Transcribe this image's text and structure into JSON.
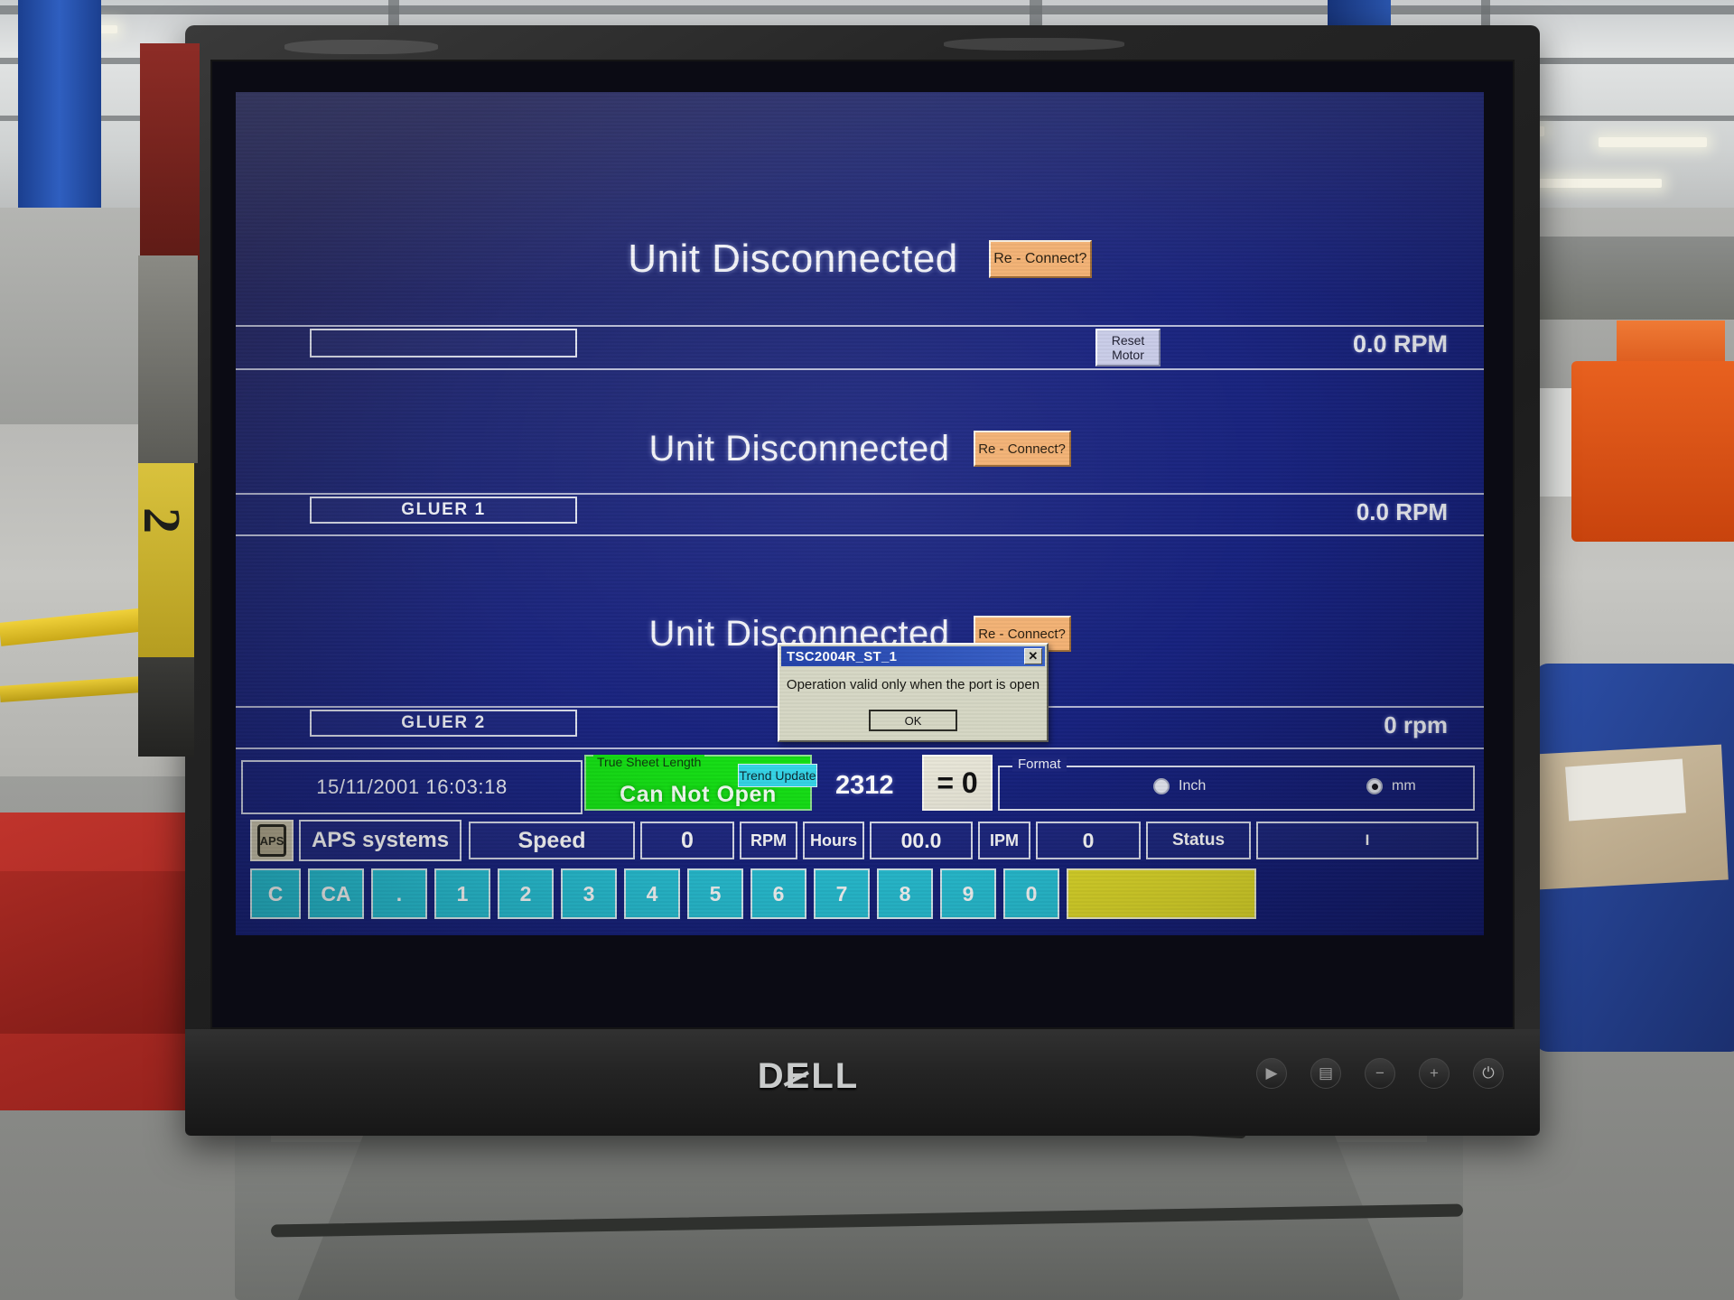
{
  "environment": {
    "scene": "factory-floor-warehouse",
    "monitor_brand": "DELL"
  },
  "screen": {
    "sections": [
      {
        "id": "unit-1",
        "status_text": "Unit Disconnected",
        "reconnect_label": "Re - Connect?",
        "field_value": "",
        "rpm_value": "0.0 RPM",
        "reset_motor_line1": "Reset",
        "reset_motor_line2": "Motor"
      },
      {
        "id": "unit-2",
        "status_text": "Unit Disconnected",
        "reconnect_label": "Re - Connect?",
        "field_value": "GLUER 1",
        "rpm_value": "0.0 RPM"
      },
      {
        "id": "unit-3",
        "status_text": "Unit Disconnected",
        "reconnect_label": "Re - Connect?",
        "field_value": "GLUER 2",
        "rpm_value": "0 rpm"
      }
    ],
    "status_strip": {
      "datetime": "15/11/2001 16:03:18",
      "true_sheet_length": {
        "legend": "True Sheet Length",
        "value": "Can Not Open",
        "trend_update_label": "Trend Update"
      },
      "counter_value": "2312",
      "equals_display": "= 0",
      "format": {
        "legend": "Format",
        "options": [
          {
            "label": "Inch",
            "selected": false
          },
          {
            "label": "mm",
            "selected": true
          }
        ]
      }
    },
    "toolbar": {
      "logo_text": "APS",
      "brand_label": "APS systems",
      "cells": [
        {
          "name": "speed-label",
          "text": "Speed"
        },
        {
          "name": "speed-value",
          "text": "0"
        },
        {
          "name": "rpm-unit",
          "text": "RPM"
        },
        {
          "name": "hours-label",
          "text": "Hours"
        },
        {
          "name": "hours-value",
          "text": "00.0"
        },
        {
          "name": "ipm-label",
          "text": "IPM"
        },
        {
          "name": "ipm-value",
          "text": "0"
        },
        {
          "name": "status-label",
          "text": "Status"
        },
        {
          "name": "status-value",
          "text": "I"
        }
      ]
    },
    "keypad": {
      "keys": [
        "C",
        "CA",
        ".",
        "1",
        "2",
        "3",
        "4",
        "5",
        "6",
        "7",
        "8",
        "9",
        "0"
      ],
      "enter_key_label": ""
    },
    "dialog": {
      "title": "TSC2004R_ST_1",
      "close_label": "✕",
      "message": "Operation valid only when the port is open",
      "ok_label": "OK"
    }
  },
  "monitor": {
    "brand": "DELL",
    "buttons": [
      "input-source-icon",
      "menu-icon",
      "brightness-down-icon",
      "brightness-up-icon",
      "power-icon"
    ]
  },
  "colors": {
    "screen_blue": "#1b2580",
    "accent_orange": "#f3b173",
    "accent_green": "#15e015",
    "accent_cyan": "#28c3d8",
    "accent_yellow": "#e2dd2b",
    "dialog_grey": "#d6d7c4",
    "titlebar_blue": "#1f3fa8"
  }
}
